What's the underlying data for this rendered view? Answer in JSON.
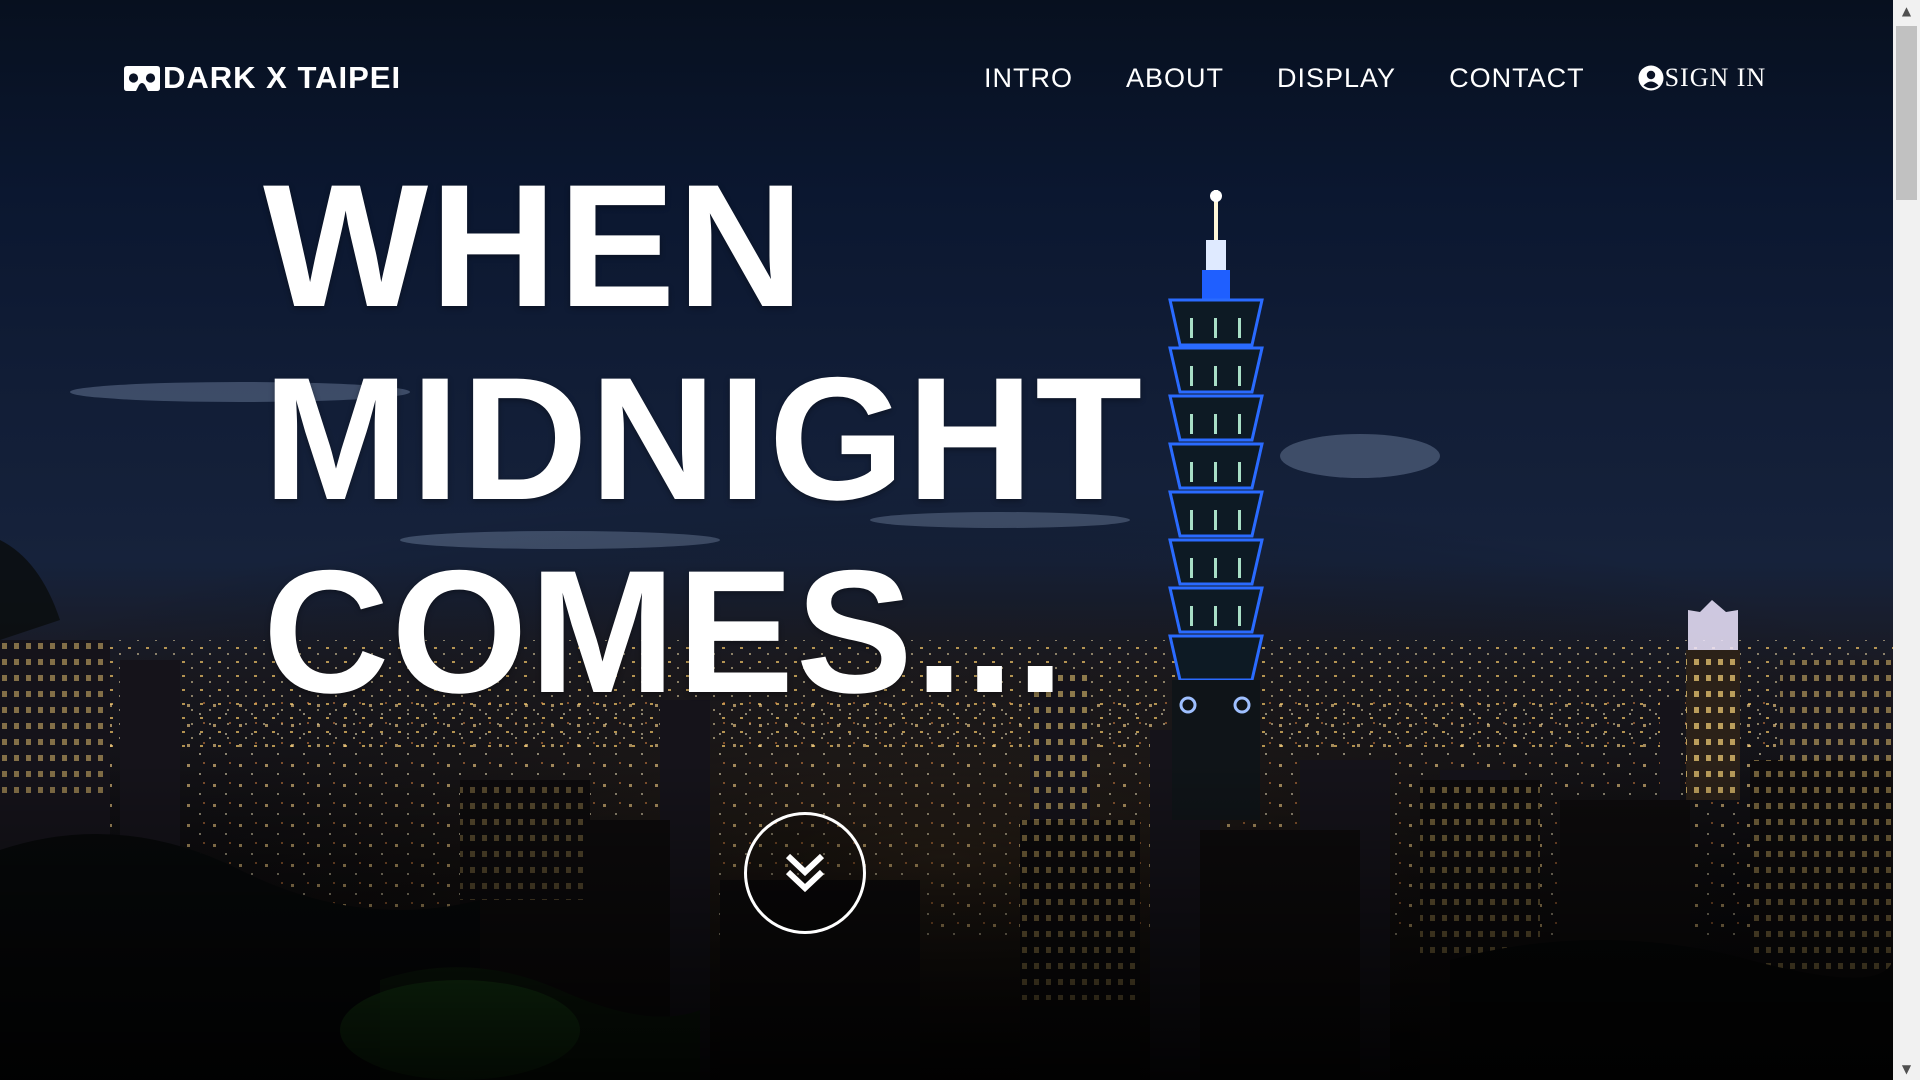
{
  "colors": {
    "sky_top": "#07101f",
    "sky_mid": "#16223b",
    "tower_accent_blue": "#2a6bff",
    "tower_light_green": "#b9f5d8",
    "city_light_warm": "#ffcf6a",
    "text": "#ffffff",
    "scrollbar_track": "#f1f1f1",
    "scrollbar_thumb": "#c1c1c1"
  },
  "header": {
    "brand": {
      "icon": "vr-goggles-icon",
      "label": "DARK X TAIPEI"
    },
    "nav": {
      "items": [
        {
          "label": "INTRO"
        },
        {
          "label": "ABOUT"
        },
        {
          "label": "DISPLAY"
        },
        {
          "label": "CONTACT"
        }
      ],
      "sign_in": {
        "icon": "user-circle-icon",
        "label": "SIGN IN"
      }
    }
  },
  "hero": {
    "headline": [
      "WHEN",
      "MIDNIGHT",
      "COMES..."
    ],
    "background_image": "taipei-night-skyline-taipei-101",
    "scroll_button_icon": "double-chevron-down-icon"
  },
  "scrollbar": {
    "up_icon": "scroll-up-arrow-icon",
    "down_icon": "scroll-down-arrow-icon"
  }
}
